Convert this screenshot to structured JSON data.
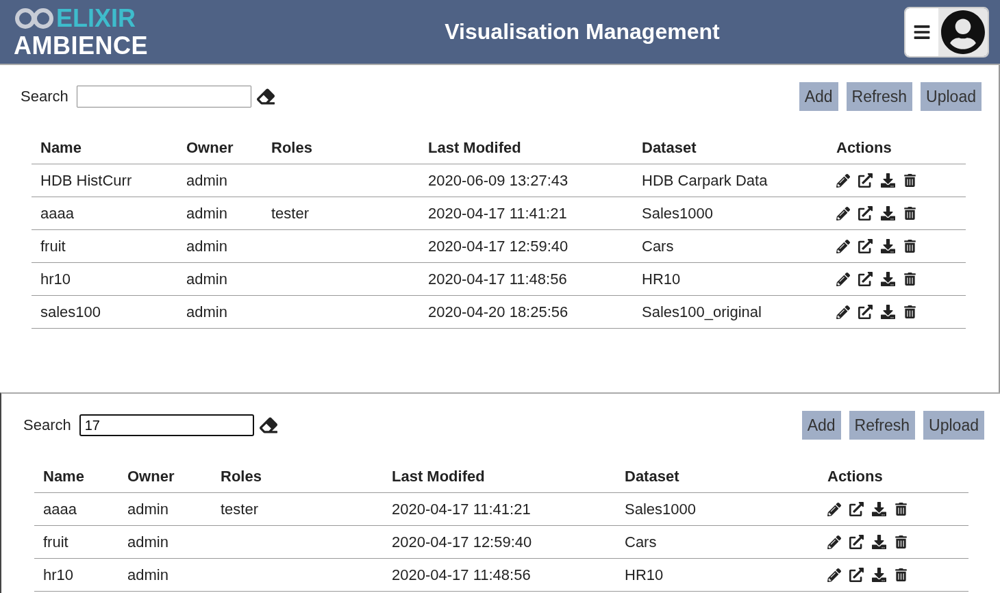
{
  "header": {
    "logo_top": "ELIXIR",
    "logo_bottom": "AMBIENCE",
    "title": "Visualisation Management"
  },
  "panels": [
    {
      "search": {
        "label": "Search",
        "focused": false
      },
      "buttons": [
        "Add",
        "Refresh",
        "Upload"
      ],
      "columns": [
        "Name",
        "Owner",
        "Roles",
        "Last Modifed",
        "Dataset",
        "Actions"
      ],
      "rows": [
        {
          "name": "HDB HistCurr",
          "owner": "admin",
          "modified": "2020-06-09 13:27:43",
          "dataset": "HDB Carpark Data"
        },
        {
          "name": "aaaa",
          "owner": "admin",
          "roles": "tester",
          "modified": "2020-04-17 11:41:21",
          "dataset": "Sales1000"
        },
        {
          "name": "fruit",
          "owner": "admin",
          "modified": "2020-04-17 12:59:40",
          "dataset": "Cars"
        },
        {
          "name": "hr10",
          "owner": "admin",
          "modified": "2020-04-17 11:48:56",
          "dataset": "HR10"
        },
        {
          "name": "sales100",
          "owner": "admin",
          "modified": "2020-04-20 18:25:56",
          "dataset": "Sales100_original"
        }
      ]
    },
    {
      "search": {
        "label": "Search",
        "value": "17",
        "focused": true
      },
      "buttons": [
        "Add",
        "Refresh",
        "Upload"
      ],
      "columns": [
        "Name",
        "Owner",
        "Roles",
        "Last Modifed",
        "Dataset",
        "Actions"
      ],
      "rows": [
        {
          "name": "aaaa",
          "owner": "admin",
          "roles": "tester",
          "modified": "2020-04-17 11:41:21",
          "dataset": "Sales1000"
        },
        {
          "name": "fruit",
          "owner": "admin",
          "modified": "2020-04-17 12:59:40",
          "dataset": "Cars"
        },
        {
          "name": "hr10",
          "owner": "admin",
          "modified": "2020-04-17 11:48:56",
          "dataset": "HR10"
        }
      ]
    }
  ]
}
